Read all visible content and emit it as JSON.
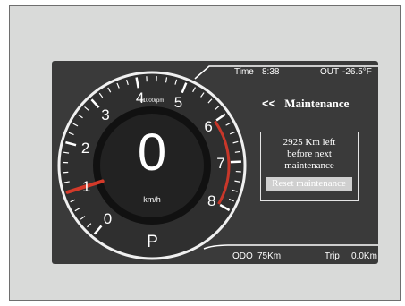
{
  "status": {
    "time_label": "Time",
    "time_value": "8:38",
    "out_label": "OUT",
    "out_value": "-26.5°F"
  },
  "odometer": {
    "odo_label": "ODO",
    "odo_value": "75Km",
    "trip_label": "Trip",
    "trip_value": "0.0Km"
  },
  "maintenance": {
    "chevron": "<<",
    "title": "Maintenance",
    "message": [
      "2925 Km left",
      "before next",
      "maintenance"
    ],
    "reset_label": "Reset maintenance"
  },
  "gauge": {
    "speed": "0",
    "speed_unit": "km/h",
    "rpm_unit": "x1000rpm",
    "gear": "P",
    "rpm_value": 1,
    "rpm_max": 8,
    "redline_from": 6,
    "tick_labels": [
      "0",
      "1",
      "2",
      "3",
      "4",
      "5",
      "6",
      "7",
      "8"
    ]
  },
  "colors": {
    "panel": "#3a3a3a",
    "frame": "#d9dad9",
    "needle": "#d43a2a",
    "redline": "#c8372a",
    "reset_highlight": "#cfcfcf"
  }
}
